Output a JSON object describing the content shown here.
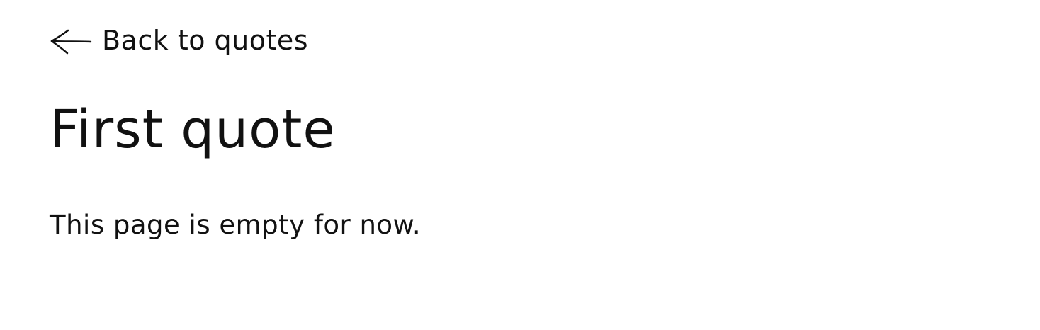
{
  "nav": {
    "back_label": "Back to quotes",
    "back_icon": "arrow-left-icon"
  },
  "quote": {
    "title": "First quote",
    "body": "This page is empty for now."
  }
}
